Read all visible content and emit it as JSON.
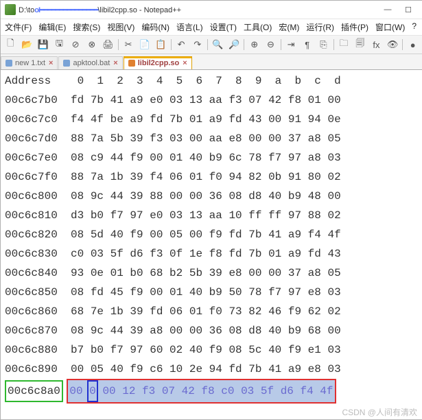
{
  "window": {
    "path_prefix": "D:\\to",
    "path_suffix": "\\libil2cpp.so - Notepad++"
  },
  "menu": [
    "文件(F)",
    "编辑(E)",
    "搜索(S)",
    "视图(V)",
    "编码(N)",
    "语言(L)",
    "设置(T)",
    "工具(O)",
    "宏(M)",
    "运行(R)",
    "插件(P)",
    "窗口(W)",
    "?"
  ],
  "tabs": [
    {
      "label": "new 1.txt"
    },
    {
      "label": "apktool.bat"
    },
    {
      "label": "libil2cpp.so",
      "active": true
    }
  ],
  "hex": {
    "header": "Address    0  1  2  3  4  5  6  7  8  9  a  b  c  d",
    "rows": [
      {
        "addr": "00c6c7b0",
        "bytes": "fd 7b 41 a9 e0 03 13 aa f3 07 42 f8 01 00"
      },
      {
        "addr": "00c6c7c0",
        "bytes": "f4 4f be a9 fd 7b 01 a9 fd 43 00 91 94 0e"
      },
      {
        "addr": "00c6c7d0",
        "bytes": "88 7a 5b 39 f3 03 00 aa e8 00 00 37 a8 05"
      },
      {
        "addr": "00c6c7e0",
        "bytes": "08 c9 44 f9 00 01 40 b9 6c 78 f7 97 a8 03"
      },
      {
        "addr": "00c6c7f0",
        "bytes": "88 7a 1b 39 f4 06 01 f0 94 82 0b 91 80 02"
      },
      {
        "addr": "00c6c800",
        "bytes": "08 9c 44 39 88 00 00 36 08 d8 40 b9 48 00"
      },
      {
        "addr": "00c6c810",
        "bytes": "d3 b0 f7 97 e0 03 13 aa 10 ff ff 97 88 02"
      },
      {
        "addr": "00c6c820",
        "bytes": "08 5d 40 f9 00 05 00 f9 fd 7b 41 a9 f4 4f"
      },
      {
        "addr": "00c6c830",
        "bytes": "c0 03 5f d6 f3 0f 1e f8 fd 7b 01 a9 fd 43"
      },
      {
        "addr": "00c6c840",
        "bytes": "93 0e 01 b0 68 b2 5b 39 e8 00 00 37 a8 05"
      },
      {
        "addr": "00c6c850",
        "bytes": "08 fd 45 f9 00 01 40 b9 50 78 f7 97 e8 03"
      },
      {
        "addr": "00c6c860",
        "bytes": "68 7e 1b 39 fd 06 01 f0 73 82 46 f9 62 02"
      },
      {
        "addr": "00c6c870",
        "bytes": "08 9c 44 39 a8 00 00 36 08 d8 40 b9 68 00"
      },
      {
        "addr": "00c6c880",
        "bytes": "b7 b0 f7 97 60 02 40 f9 08 5c 40 f9 e1 03"
      },
      {
        "addr": "00c6c890",
        "bytes": "00 05 40 f9 c6 10 2e 94 fd 7b 41 a9 e8 03"
      }
    ],
    "selected": {
      "addr": "00c6c8a0",
      "b0": "00",
      "b1": "0",
      "rest": " 00 12 f3 07 42 f8 c0 03 5f d6 f4 4f"
    }
  },
  "watermark": "CSDN @人间有清欢"
}
